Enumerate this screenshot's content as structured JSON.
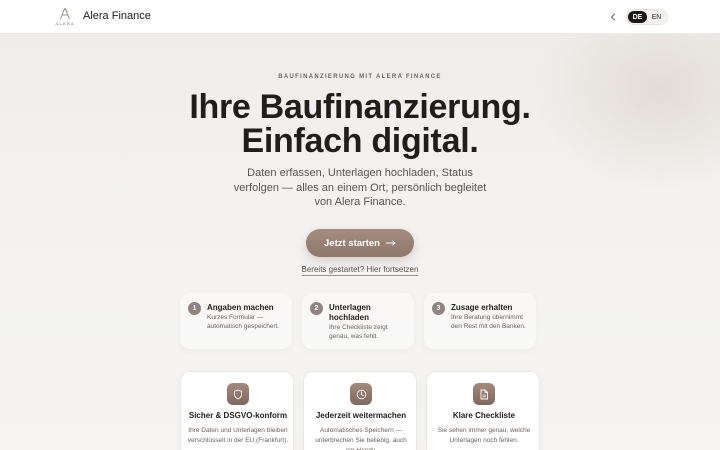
{
  "header": {
    "logo_text": "ALERA",
    "brand": "Alera Finance",
    "back_icon": "chevron-left-icon",
    "languages": [
      {
        "label": "DE",
        "active": true
      },
      {
        "label": "EN",
        "active": false
      }
    ]
  },
  "hero": {
    "eyebrow": "BAUFINANZIERUNG MIT ALERA FINANCE",
    "title_line1": "Ihre Baufinanzierung.",
    "title_line2": "Einfach digital.",
    "subtitle": "Daten erfassen, Unterlagen hochladen, Status verfolgen — alles an einem Ort, persönlich begleitet von Alera Finance.",
    "cta_label": "Jetzt starten",
    "cta_icon": "arrow-right-icon",
    "resume_link": "Bereits gestartet? Hier fortsetzen"
  },
  "steps": [
    {
      "number": "1",
      "title": "Angaben machen",
      "desc": "Kurzes Formular — automatisch gespeichert."
    },
    {
      "number": "2",
      "title": "Unterlagen hochladen",
      "desc": "Ihre Checkliste zeigt genau, was fehlt."
    },
    {
      "number": "3",
      "title": "Zusage erhalten",
      "desc": "Ihre Beratung übernimmt den Rest mit den Banken."
    }
  ],
  "features": [
    {
      "icon": "shield-icon",
      "title": "Sicher & DSGVO-konform",
      "desc": "Ihre Daten und Unterlagen bleiben verschlüsselt in der EU (Frankfurt)."
    },
    {
      "icon": "clock-icon",
      "title": "Jederzeit weitermachen",
      "desc": "Automatisches Speichern — unterbrechen Sie beliebig, auch am Handy."
    },
    {
      "icon": "document-icon",
      "title": "Klare Checkliste",
      "desc": "Sie sehen immer genau, welche Unterlagen noch fehlen."
    }
  ],
  "colors": {
    "accent": "#9a8276",
    "step_badge": "#8f8480",
    "text_dark": "#231d1a"
  }
}
